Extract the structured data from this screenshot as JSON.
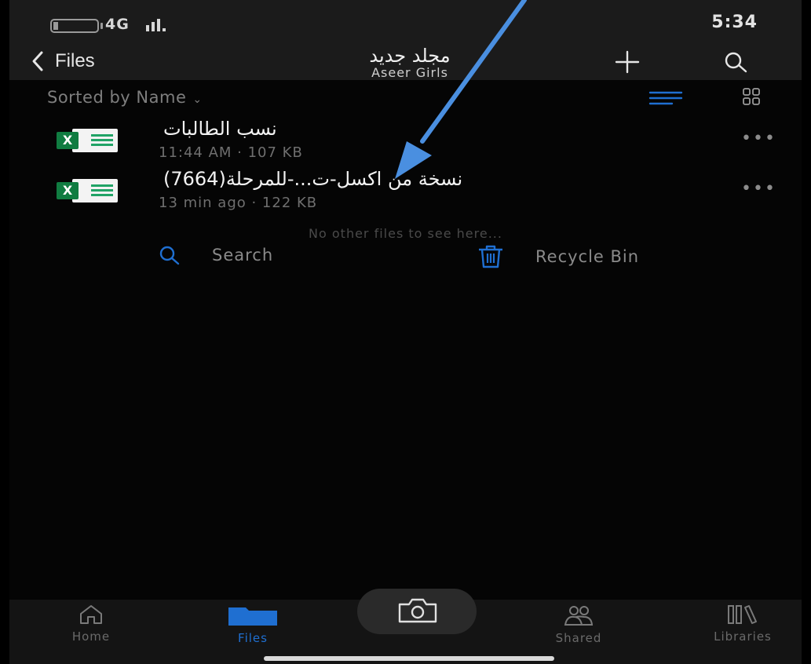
{
  "status_bar": {
    "network": "4G",
    "time": "5:34"
  },
  "header": {
    "back_label": "Files",
    "title": "مجلد جديد",
    "subtitle": "Aseer Girls"
  },
  "sort": {
    "label": "Sorted by Name"
  },
  "files": [
    {
      "name": "نسب الطالبات",
      "meta": "11:44 AM · 107 KB",
      "icon": "excel-file-icon"
    },
    {
      "name": "نسخة من اكسل-ت...-للمرحلة(7664)",
      "meta": "13 min ago · 122 KB",
      "icon": "excel-file-icon"
    }
  ],
  "empty_note": "No other files to see here...",
  "actions": {
    "search_label": "Search",
    "recycle_label": "Recycle Bin"
  },
  "tabs": [
    {
      "label": "Home",
      "icon": "home-icon"
    },
    {
      "label": "Files",
      "icon": "folder-icon",
      "active": true
    },
    {
      "label": "Shared",
      "icon": "people-icon"
    },
    {
      "label": "Libraries",
      "icon": "libraries-icon"
    }
  ],
  "colors": {
    "accent": "#1f6fd1",
    "excel": "#107c41",
    "annotation_arrow": "#4a8fe0"
  }
}
